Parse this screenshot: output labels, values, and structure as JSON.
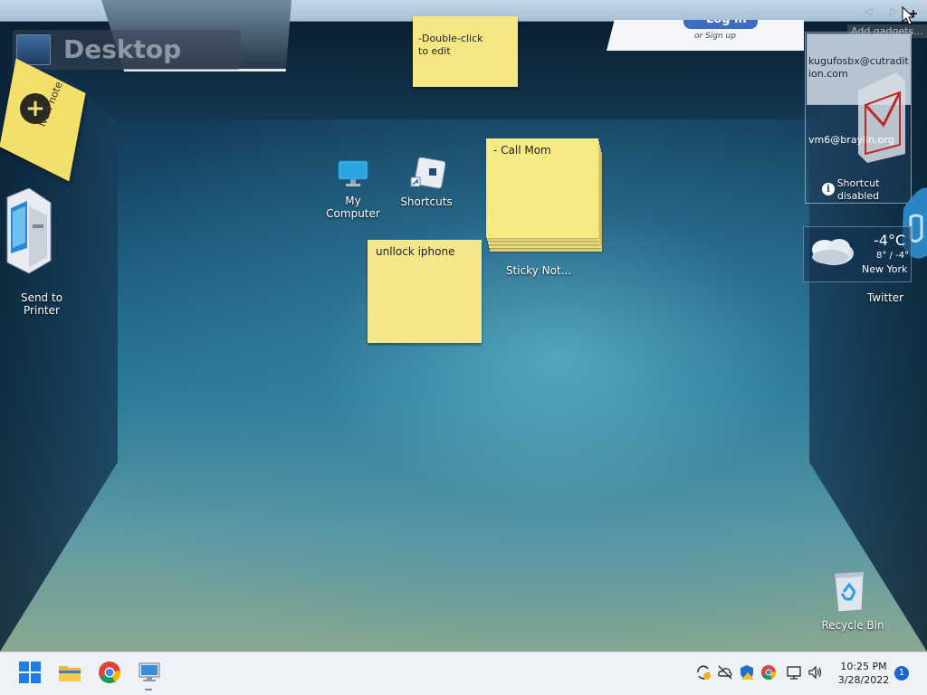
{
  "desktop": {
    "title": "Desktop",
    "nav_arrows": "◁ ▷",
    "add_gadgets": "Add gadgets..."
  },
  "sticky_notes": {
    "top_note": "-Double-click\nto edit",
    "new_note_label": "New note",
    "stack_note": "- Call Mom",
    "stack_label": "Sticky Not...",
    "unlock_note": "unllock iphone"
  },
  "icons": {
    "send_to_printer": "Send to\nPrinter",
    "my_computer": "My\nComputer",
    "shortcuts": "Shortcuts",
    "recycle_bin": "Recycle Bin",
    "twitter": "Twitter"
  },
  "login_gadget": {
    "button": "Log in",
    "signup": "or Sign up"
  },
  "mail_gadget": {
    "address1": "kugufosbx@cutradition.com",
    "address2": "vm6@braylin.org",
    "status": "Shortcut\ndisabled"
  },
  "weather": {
    "temp": "-4°C",
    "range": "8° / -4°",
    "city": "New York"
  },
  "taskbar": {
    "time": "10:25 PM",
    "date": "3/28/2022",
    "notifications": "1"
  }
}
